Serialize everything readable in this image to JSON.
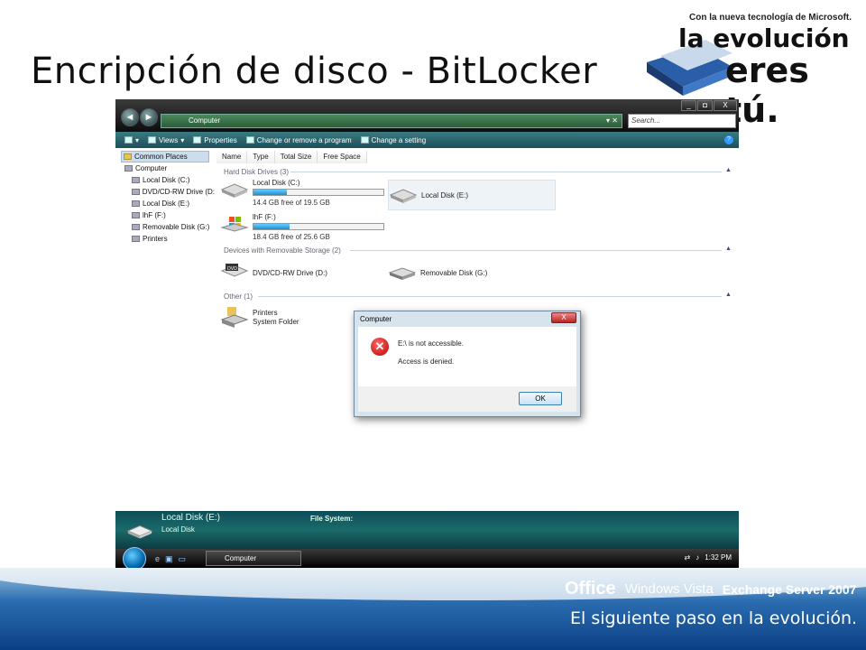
{
  "slide": {
    "title": "Encripción de disco - BitLocker"
  },
  "logo_top": {
    "tagline": "Con la nueva tecnología de Microsoft.",
    "line1": "la evolución",
    "line2": "eres tú."
  },
  "window": {
    "address": "Computer",
    "search_placeholder": "Search...",
    "win_buttons": [
      "_",
      "◘",
      "X"
    ],
    "toolbar": {
      "organize": "",
      "views": "Views",
      "properties": "Properties",
      "change_program": "Change or remove a program",
      "change_setting": "Change a setting"
    },
    "nav": {
      "items": [
        "Common Places",
        "Computer",
        "Local Disk (C:)",
        "DVD/CD-RW Drive (D:",
        "Local Disk (E:)",
        "lhF (F:)",
        "Removable Disk (G:)",
        "Printers"
      ]
    },
    "columns": [
      "Name",
      "Type",
      "Total Size",
      "Free Space"
    ],
    "groups": {
      "hdd": "Hard Disk Drives (3)",
      "removable": "Devices with Removable Storage (2)",
      "other": "Other (1)"
    },
    "drives": {
      "c": {
        "name": "Local Disk (C:)",
        "free": "14.4 GB free of 19.5 GB",
        "used_fraction": 0.26
      },
      "e": {
        "name": "Local Disk (E:)"
      },
      "f": {
        "name": "lhF (F:)",
        "free": "18.4 GB free of 25.6 GB",
        "used_fraction": 0.28
      },
      "d": {
        "name": "DVD/CD-RW Drive (D:)"
      },
      "g": {
        "name": "Removable Disk (G:)"
      },
      "printers": {
        "name": "Printers",
        "sub": "System Folder"
      }
    },
    "dialog": {
      "title": "Computer",
      "close": "X",
      "message1": "E:\\ is not accessible.",
      "message2": "Access is denied.",
      "ok": "OK"
    },
    "details": {
      "title": "Local Disk (E:)",
      "subtitle": "Local Disk",
      "filesystem_label": "File System:"
    },
    "taskbar": {
      "task_label": "Computer",
      "time": "1:32 PM"
    }
  },
  "footer": {
    "office": "Office",
    "vista": "Windows Vista",
    "exchange": "Exchange Server 2007",
    "tagline": "El siguiente paso en la evolución."
  }
}
